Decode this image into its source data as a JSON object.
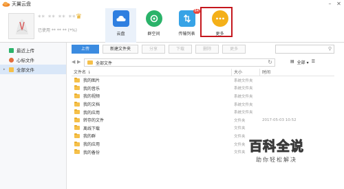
{
  "app": {
    "title": "天翼云盘"
  },
  "window": {
    "min_symbol": "–",
    "close_symbol": "✕"
  },
  "user": {
    "name": "** ** ** **",
    "quota": "已使用 ** ** ** (*%)"
  },
  "nav": [
    {
      "label": "云盘",
      "icon": "cloud-disk-icon",
      "color": "#2f7fe0"
    },
    {
      "label": "群空间",
      "icon": "group-space-icon",
      "color": "#2bb36a"
    },
    {
      "label": "传输列表",
      "icon": "transfer-icon",
      "color": "#37a3e6",
      "badge": "64"
    },
    {
      "label": "更多",
      "icon": "more-icon",
      "color": "#f4b019"
    }
  ],
  "sidebar": {
    "items": [
      {
        "label": "最近上传",
        "icon": "recent-upload-icon",
        "color": "#2bb36a"
      },
      {
        "label": "心标文件",
        "icon": "heart-icon",
        "color": "#e36d3d"
      },
      {
        "label": "全部文件",
        "icon": "folder-icon",
        "color": "#f5c04a"
      }
    ]
  },
  "toolbar": {
    "upload": "上传",
    "new_folder": "新建文件夹",
    "share": "分享",
    "download": "下载",
    "delete": "删除",
    "more": "更多"
  },
  "address": {
    "path": "全部文件",
    "view": "全部 ▾"
  },
  "table": {
    "headers": {
      "name": "文件名 ⇂",
      "size": "大小",
      "time": "时间"
    },
    "rows": [
      {
        "name": "我的图片",
        "size": "系统文件夹",
        "time": ""
      },
      {
        "name": "我的音乐",
        "size": "系统文件夹",
        "time": ""
      },
      {
        "name": "我的视频",
        "size": "系统文件夹",
        "time": ""
      },
      {
        "name": "我的文档",
        "size": "系统文件夹",
        "time": ""
      },
      {
        "name": "我的应用",
        "size": "系统文件夹",
        "time": ""
      },
      {
        "name": "转存的文件",
        "size": "文件夹",
        "time": "2017-05-03 10:52"
      },
      {
        "name": "离线下载",
        "size": "文件夹",
        "time": ""
      },
      {
        "name": "我的群",
        "size": "文件夹",
        "time": ""
      },
      {
        "name": "我的应用",
        "size": "文件夹",
        "time": ""
      },
      {
        "name": "我的备份",
        "size": "文件夹",
        "time": ""
      }
    ]
  },
  "watermark": {
    "title": "百科全说",
    "subtitle": "助你轻松解决"
  }
}
